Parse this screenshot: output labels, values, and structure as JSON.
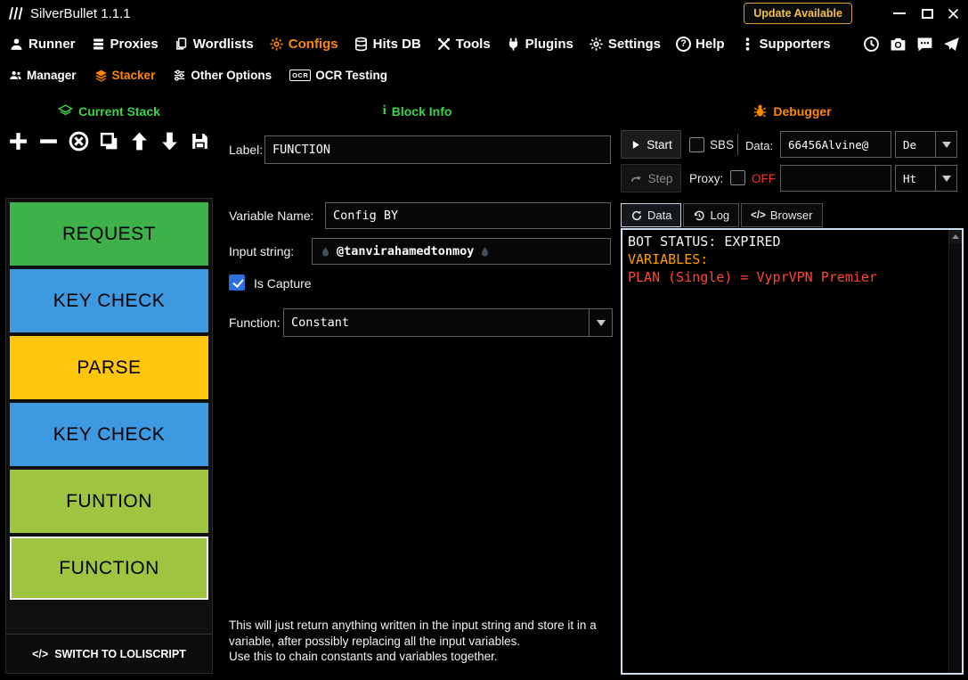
{
  "titlebar": {
    "title": "SilverBullet 1.1.1",
    "update_label": "Update Available"
  },
  "menubar": {
    "items": [
      {
        "label": "Runner"
      },
      {
        "label": "Proxies"
      },
      {
        "label": "Wordlists"
      },
      {
        "label": "Configs"
      },
      {
        "label": "Hits DB"
      },
      {
        "label": "Tools"
      },
      {
        "label": "Plugins"
      },
      {
        "label": "Settings"
      },
      {
        "label": "Help"
      },
      {
        "label": "Supporters"
      }
    ]
  },
  "subnav": {
    "items": [
      {
        "label": "Manager"
      },
      {
        "label": "Stacker"
      },
      {
        "label": "Other Options"
      },
      {
        "label": "OCR Testing"
      }
    ]
  },
  "icons": {
    "help_glyph": "?",
    "info_glyph": "i",
    "ocr_glyph": "OCR",
    "code_glyph": "</>"
  },
  "stack": {
    "title": "Current Stack",
    "blocks": [
      {
        "label": "REQUEST",
        "color": "#3eb14a"
      },
      {
        "label": "KEY CHECK",
        "color": "#3d9ae0"
      },
      {
        "label": "PARSE",
        "color": "#ffc60b"
      },
      {
        "label": "KEY CHECK",
        "color": "#3d9ae0"
      },
      {
        "label": "FUNTION",
        "color": "#9fc43f"
      },
      {
        "label": "FUNCTION",
        "color": "#9fc43f"
      }
    ],
    "switch_label": "SWITCH TO LOLISCRIPT"
  },
  "block_info": {
    "title": "Block Info",
    "label_label": "Label:",
    "label_value": "FUNCTION",
    "variable_label": "Variable Name:",
    "variable_value": "Config BY",
    "input_label": "Input string:",
    "input_value": "@tanvirahamedtonmoy",
    "capture_label": "Is Capture",
    "function_label": "Function:",
    "function_value": "Constant",
    "description1": "This will just return anything written in the input string and store it in a variable, after possibly replacing all the input variables.",
    "description2": "Use this to chain constants and variables together."
  },
  "debugger": {
    "title": "Debugger",
    "start_label": "Start",
    "step_label": "Step",
    "sbs_label": "SBS",
    "data_label": "Data:",
    "data_value": "66456Alvine@",
    "data_combo": "De",
    "proxy_label": "Proxy:",
    "proxy_status": "OFF",
    "proxy_combo": "Ht",
    "tabs": [
      {
        "label": "Data"
      },
      {
        "label": "Log"
      },
      {
        "label": "Browser"
      }
    ],
    "console": [
      {
        "text": "BOT STATUS: EXPIRED",
        "color": "#f5f5f5"
      },
      {
        "text": "VARIABLES:",
        "color": "#ff9d00"
      },
      {
        "text": "PLAN (Single) = VyprVPN Premier",
        "color": "#ff4632"
      }
    ]
  }
}
